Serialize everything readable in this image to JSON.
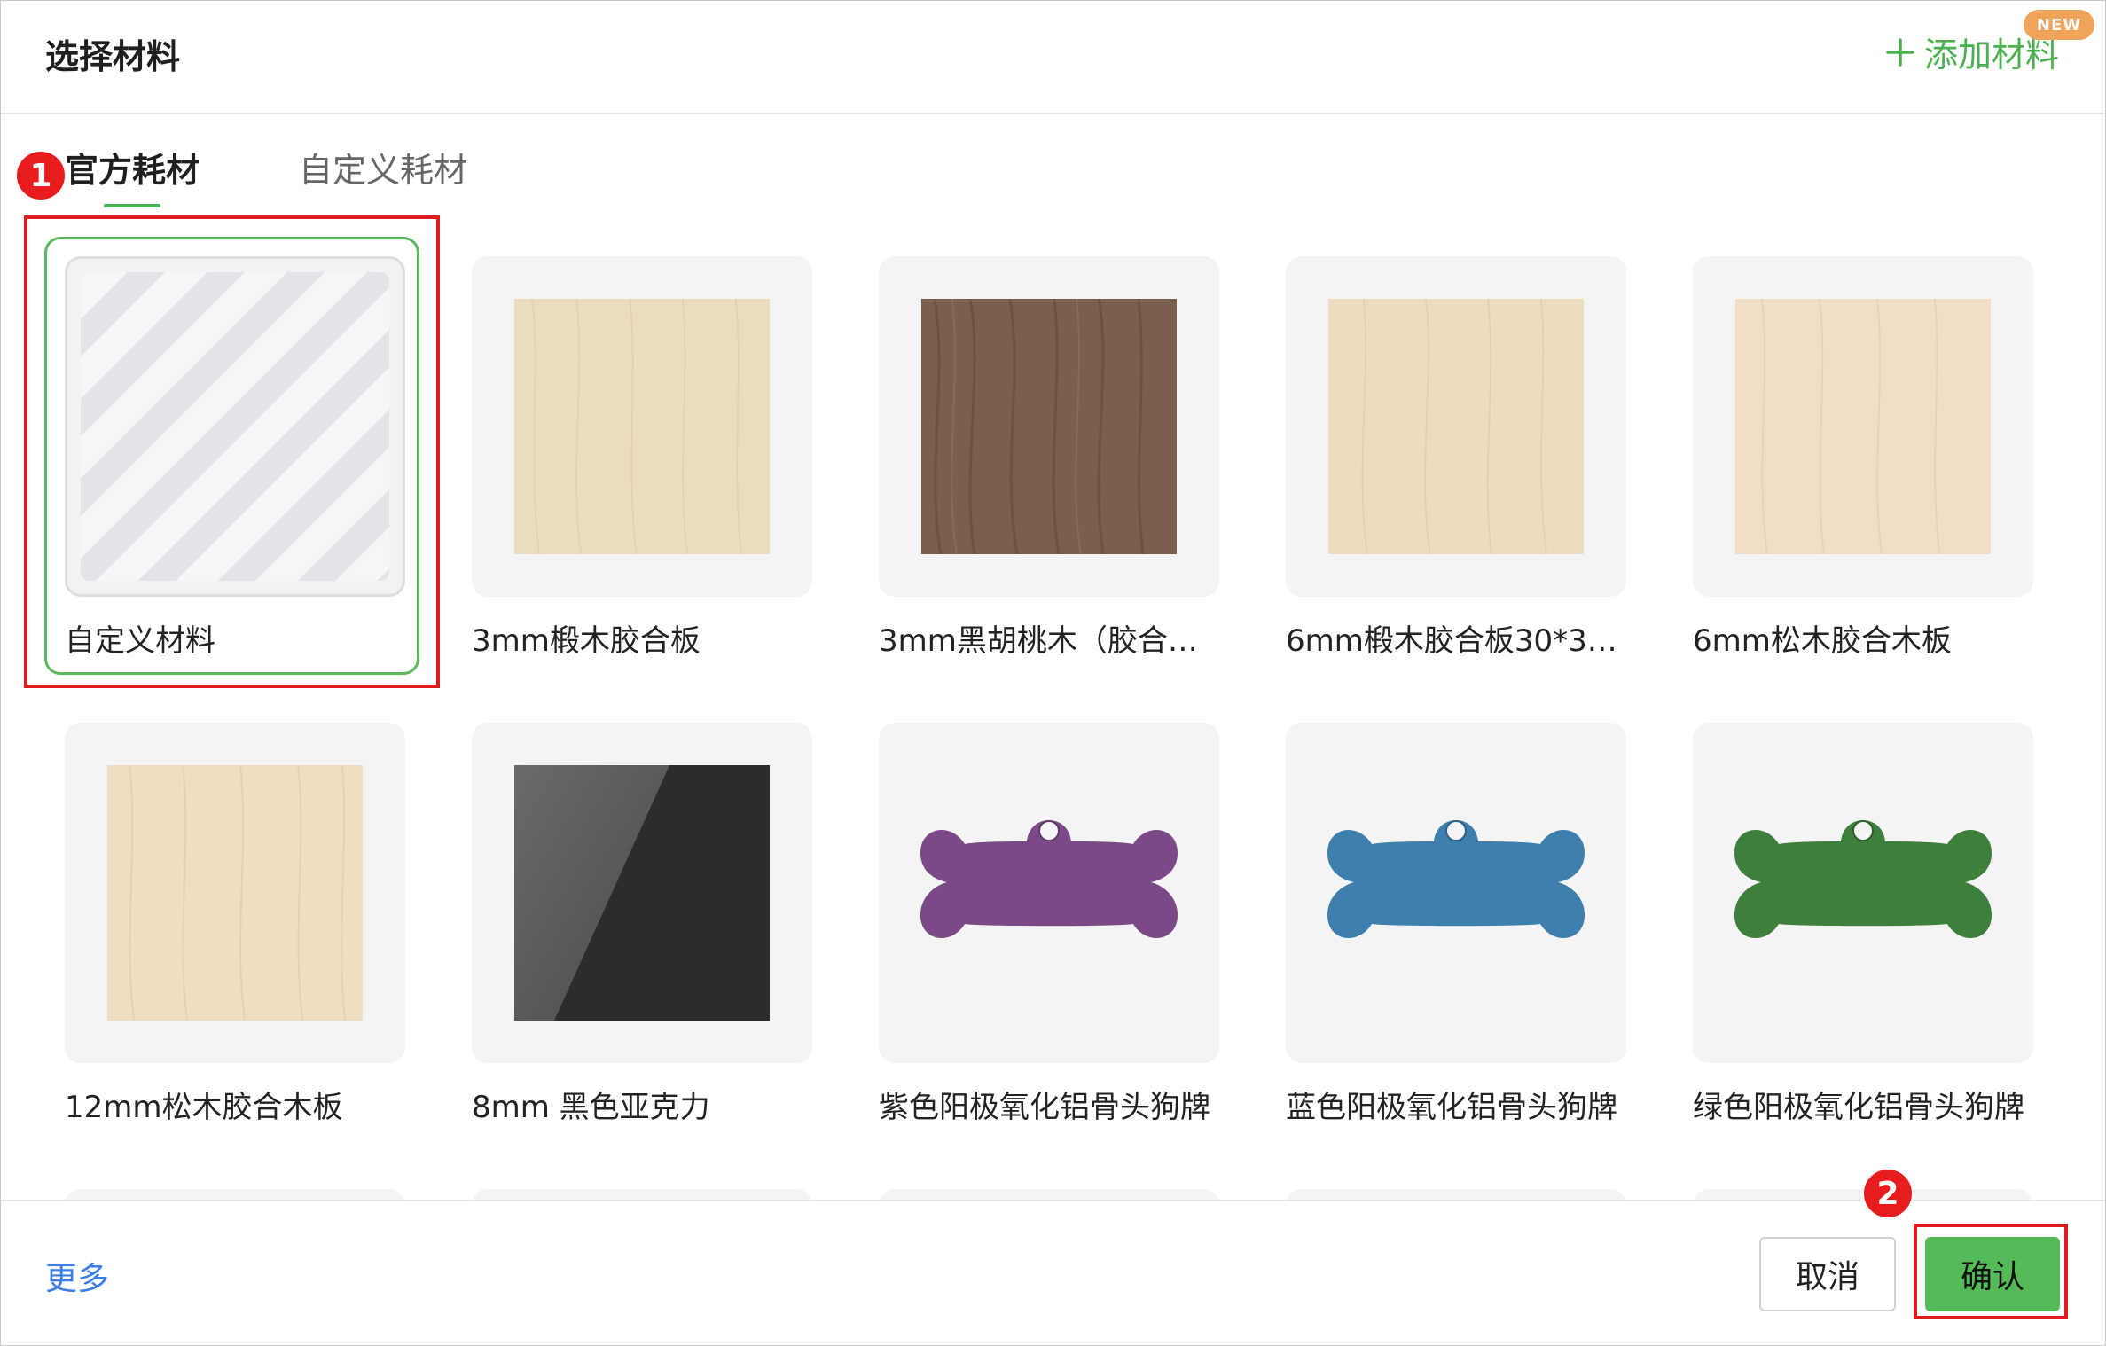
{
  "dialog": {
    "title": "选择材料",
    "add_material_label": "添加材料",
    "new_badge": "NEW",
    "accent_color": "#4caf50"
  },
  "tabs": [
    {
      "label": "官方耗材",
      "active": true
    },
    {
      "label": "自定义耗材",
      "active": false
    }
  ],
  "materials": [
    {
      "label": "自定义材料",
      "image": "striped-placeholder",
      "selected": true
    },
    {
      "label": "3mm椴木胶合板",
      "image": "light-wood"
    },
    {
      "label": "3mm黑胡桃木（胶合）...",
      "image": "walnut-wood"
    },
    {
      "label": "6mm椴木胶合板30*30...",
      "image": "light-wood"
    },
    {
      "label": "6mm松木胶合木板",
      "image": "light-wood"
    },
    {
      "label": "12mm松木胶合木板",
      "image": "light-wood"
    },
    {
      "label": "8mm 黑色亚克力",
      "image": "black-acrylic"
    },
    {
      "label": "紫色阳极氧化铝骨头狗牌",
      "image": "bone-tag",
      "color": "#7b4a86"
    },
    {
      "label": "蓝色阳极氧化铝骨头狗牌",
      "image": "bone-tag",
      "color": "#3f7fae"
    },
    {
      "label": "绿色阳极氧化铝骨头狗牌",
      "image": "bone-tag",
      "color": "#3e7f3c"
    }
  ],
  "footer": {
    "more_label": "更多",
    "cancel_label": "取消",
    "confirm_label": "确认"
  },
  "annotations": [
    {
      "number": "1"
    },
    {
      "number": "2"
    }
  ]
}
